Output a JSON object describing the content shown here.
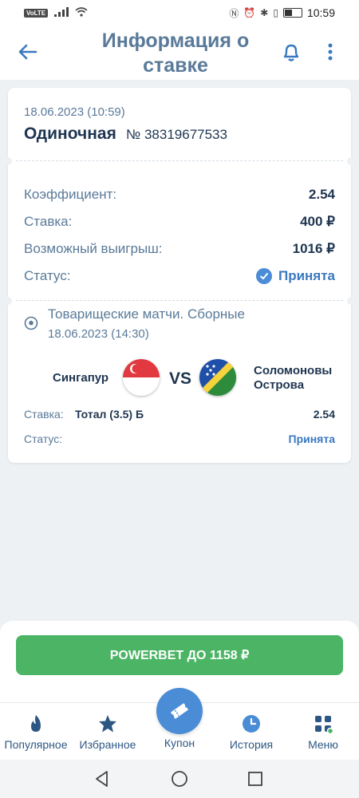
{
  "status_bar": {
    "network_badge": "VoLTE",
    "signal": "4G",
    "time": "10:59",
    "battery_pct": 40
  },
  "header": {
    "title": "Информация о ставке"
  },
  "bet": {
    "date": "18.06.2023 (10:59)",
    "type": "Одиночная",
    "number": "№ 38319677533",
    "rows": {
      "coef_label": "Коэффициент:",
      "coef_value": "2.54",
      "stake_label": "Ставка:",
      "stake_value": "400 ₽",
      "win_label": "Возможный выигрыш:",
      "win_value": "1016 ₽",
      "status_label": "Статус:",
      "status_value": "Принята"
    }
  },
  "event": {
    "league": "Товарищеские матчи. Сборные",
    "date": "18.06.2023 (14:30)",
    "team1": "Сингапур",
    "vs": "VS",
    "team2": "Соломоновы Острова",
    "stake_label": "Ставка:",
    "market": "Тотал (3.5) Б",
    "odds": "2.54",
    "status_label": "Статус:",
    "status_value": "Принята"
  },
  "powerbet": {
    "label": "POWERBET ДО 1158 ₽"
  },
  "tabs": {
    "popular": "Популярное",
    "favorites": "Избранное",
    "coupon": "Купон",
    "history": "История",
    "menu": "Меню"
  },
  "colors": {
    "title": "#5a7a99",
    "dark_text": "#1e3550",
    "accent_blue": "#4a8cd6",
    "accepted": "#3a79c1",
    "powerbet_green": "#4cb565",
    "background": "#eef1f4"
  }
}
